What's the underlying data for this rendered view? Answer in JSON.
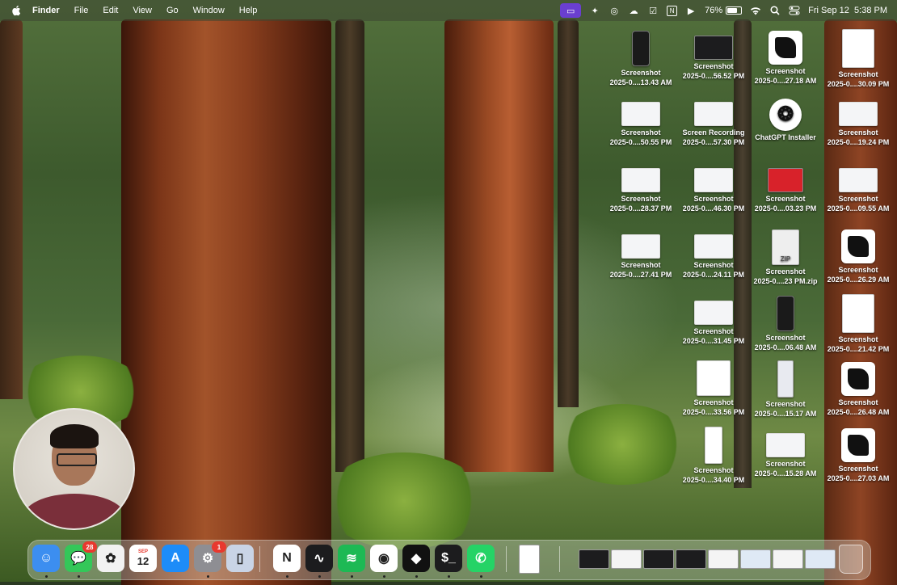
{
  "menubar": {
    "app_name": "Finder",
    "menus": [
      "File",
      "Edit",
      "View",
      "Go",
      "Window",
      "Help"
    ],
    "battery_percent": "76%",
    "battery_level": 0.76,
    "datetime": "Fri Sep 12  5:38 PM",
    "status_icons": [
      "screen-mirror-icon",
      "sparkle-icon",
      "creative-cloud-icon",
      "cloud-icon",
      "calendar-check-icon",
      "notion-icon",
      "play-circle-icon",
      "battery-icon",
      "wifi-icon",
      "search-icon",
      "control-center-icon"
    ]
  },
  "desktop": {
    "icons": [
      {
        "line1": "Screenshot",
        "line2": "2025-0....13.43 AM",
        "thumb": "phone"
      },
      {
        "line1": "Screenshot",
        "line2": "2025-0....56.52 PM",
        "thumb": "dark"
      },
      {
        "line1": "Screenshot",
        "line2": "2025-0....27.18 AM",
        "thumb": "logo"
      },
      {
        "line1": "Screenshot",
        "line2": "2025-0....30.09 PM",
        "thumb": "doc"
      },
      {
        "line1": "Screenshot",
        "line2": "2025-0....50.55 PM",
        "thumb": "wide"
      },
      {
        "line1": "Screen Recording",
        "line2": "2025-0....57.30 PM",
        "thumb": "wide"
      },
      {
        "line1": "ChatGPT Installer",
        "line2": "",
        "thumb": "gpt"
      },
      {
        "line1": "Screenshot",
        "line2": "2025-0....19.24 PM",
        "thumb": "wide"
      },
      {
        "line1": "Screenshot",
        "line2": "2025-0....28.37 PM",
        "thumb": "wide"
      },
      {
        "line1": "Screenshot",
        "line2": "2025-0....46.30 PM",
        "thumb": "wide"
      },
      {
        "line1": "Screenshot",
        "line2": "2025-0....03.23 PM",
        "thumb": "red"
      },
      {
        "line1": "Screenshot",
        "line2": "2025-0....09.55 AM",
        "thumb": "wide"
      },
      {
        "line1": "Screenshot",
        "line2": "2025-0....27.41 PM",
        "thumb": "wide"
      },
      {
        "line1": "Screenshot",
        "line2": "2025-0....24.11 PM",
        "thumb": "wide"
      },
      {
        "line1": "Screenshot",
        "line2": "2025-0....23 PM.zip",
        "thumb": "zip"
      },
      {
        "line1": "Screenshot",
        "line2": "2025-0....26.29 AM",
        "thumb": "logo"
      },
      {
        "line1": "Screenshot",
        "line2": "2025-0....31.45 PM",
        "thumb": "wide"
      },
      {
        "line1": "Screenshot",
        "line2": "2025-0....06.48 AM",
        "thumb": "phone"
      },
      {
        "line1": "Screenshot",
        "line2": "2025-0....21.42 PM",
        "thumb": "doc"
      },
      {
        "line1": "Screenshot",
        "line2": "2025-0....33.56 PM",
        "thumb": "pink"
      },
      {
        "line1": "Screenshot",
        "line2": "2025-0....15.17 AM",
        "thumb": "tall"
      },
      {
        "line1": "Screenshot",
        "line2": "2025-0....26.48 AM",
        "thumb": "logo"
      },
      {
        "line1": "Screenshot",
        "line2": "2025-0....34.40 PM",
        "thumb": "white"
      },
      {
        "line1": "Screenshot",
        "line2": "2025-0....15.28 AM",
        "thumb": "wide"
      },
      {
        "line1": "Screenshot",
        "line2": "2025-0....27.03 AM",
        "thumb": "logo"
      }
    ]
  },
  "dock": {
    "apps": [
      {
        "name": "Finder",
        "color": "#3c8ef0",
        "glyph": "☺",
        "running": true
      },
      {
        "name": "Messages",
        "color": "#34c759",
        "glyph": "💬",
        "badge": "28",
        "running": true
      },
      {
        "name": "Photos",
        "color": "#f2f2f2",
        "glyph": "✿",
        "running": false
      },
      {
        "name": "Calendar",
        "color": "#ffffff",
        "glyph": "12",
        "label": "SEP",
        "running": false
      },
      {
        "name": "App Store",
        "color": "#1d8cf8",
        "glyph": "A",
        "running": false
      },
      {
        "name": "System Settings",
        "color": "#8e8e93",
        "glyph": "⚙",
        "badge": "1",
        "running": true
      },
      {
        "name": "iPhone Mirroring",
        "color": "#c9d4e6",
        "glyph": "▯",
        "running": false
      },
      {
        "name": "Notion",
        "color": "#ffffff",
        "glyph": "N",
        "running": true
      },
      {
        "name": "Activity Monitor",
        "color": "#1c1c1e",
        "glyph": "∿",
        "running": true
      },
      {
        "name": "Spotify",
        "color": "#1db954",
        "glyph": "≋",
        "running": true
      },
      {
        "name": "Google Chrome",
        "color": "#ffffff",
        "glyph": "◉",
        "running": true
      },
      {
        "name": "Cursor",
        "color": "#111111",
        "glyph": "◆",
        "running": true
      },
      {
        "name": "Terminal",
        "color": "#1c1c1e",
        "glyph": "$_",
        "running": true
      },
      {
        "name": "WhatsApp",
        "color": "#25d366",
        "glyph": "✆",
        "running": true
      }
    ],
    "trash_label": "Trash"
  },
  "camera": {
    "label": "webcam overlay"
  }
}
